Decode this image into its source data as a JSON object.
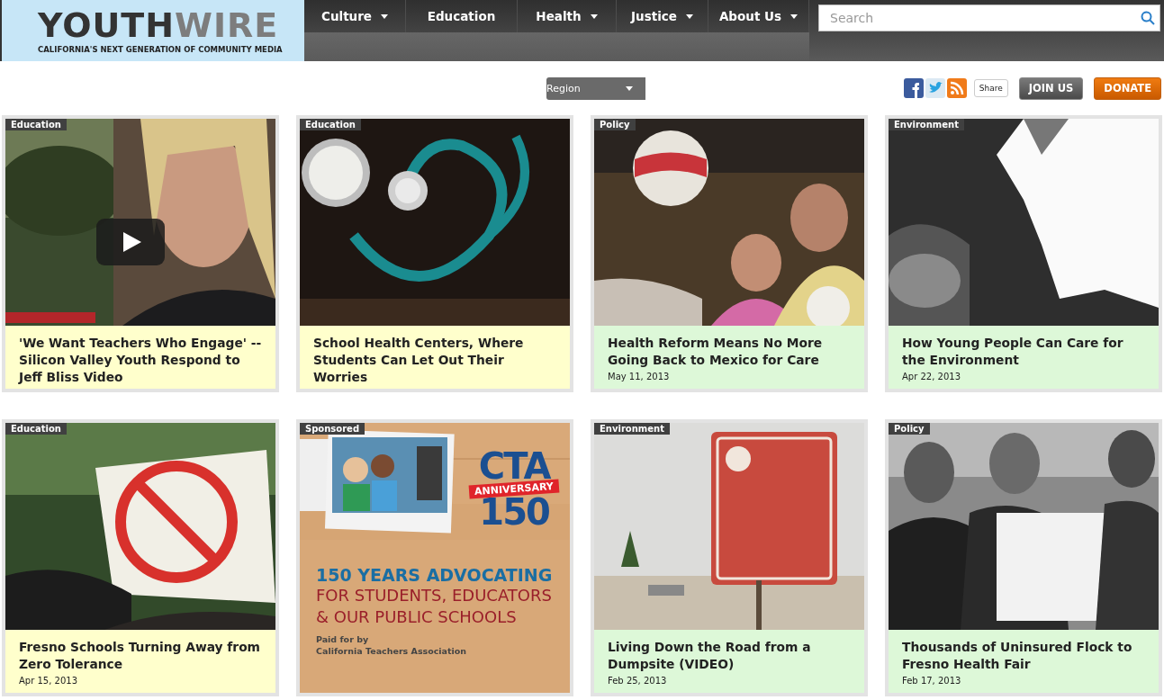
{
  "logo": {
    "word_dark": "YOUTH",
    "word_light": "WIRE",
    "tagline": "CALIFORNIA'S NEXT GENERATION OF COMMUNITY MEDIA"
  },
  "nav": [
    {
      "label": "Culture",
      "dropdown": true
    },
    {
      "label": "Education",
      "dropdown": false
    },
    {
      "label": "Health",
      "dropdown": true
    },
    {
      "label": "Justice",
      "dropdown": true
    },
    {
      "label": "About Us",
      "dropdown": true
    }
  ],
  "search": {
    "placeholder": "Search"
  },
  "region": {
    "label": "Region"
  },
  "share": {
    "label": "Share"
  },
  "buttons": [
    {
      "label": "JOIN US",
      "kind": "join"
    },
    {
      "label": "DONATE",
      "kind": "donate"
    }
  ],
  "cards": [
    {
      "kind": "article",
      "category": "Education",
      "title": "'We Want Teachers Who Engage' -- Silicon Valley Youth Respond to Jeff Bliss Video",
      "video": true,
      "color": "#ffffcc"
    },
    {
      "kind": "article",
      "category": "Education",
      "title": "School Health Centers, Where Students Can Let Out Their Worries",
      "video": false,
      "color": "#ffffcc"
    },
    {
      "kind": "article",
      "category": "Policy",
      "title": "Health Reform Means No More Going Back to Mexico for Care",
      "date": "May 11, 2013",
      "video": false,
      "color": "#ddf8d8"
    },
    {
      "kind": "article",
      "category": "Environment",
      "title": "How Young People Can Care for the Environment",
      "date": "Apr 22, 2013",
      "video": false,
      "color": "#ddf8d8"
    },
    {
      "kind": "article",
      "category": "Education",
      "title": "Fresno Schools Turning Away from Zero Tolerance",
      "date": "Apr 15, 2013",
      "video": false,
      "color": "#ffffcc"
    },
    {
      "kind": "sponsored",
      "category": "Sponsored",
      "badge": [
        "CTA",
        "ANNIVERSARY",
        "150"
      ],
      "headline": "150 YEARS ADVOCATING",
      "lines": [
        "FOR STUDENTS, EDUCATORS",
        "& OUR PUBLIC SCHOOLS"
      ],
      "paid": [
        "Paid for by",
        "California Teachers Association"
      ]
    },
    {
      "kind": "article",
      "category": "Environment",
      "title": "Living Down the Road from a Dumpsite (VIDEO)",
      "date": "Feb 25, 2013",
      "video": false,
      "color": "#ddf8d8"
    },
    {
      "kind": "article",
      "category": "Policy",
      "title": "Thousands of Uninsured Flock to Fresno Health Fair",
      "date": "Feb 17, 2013",
      "video": false,
      "color": "#ddf8d8"
    }
  ]
}
